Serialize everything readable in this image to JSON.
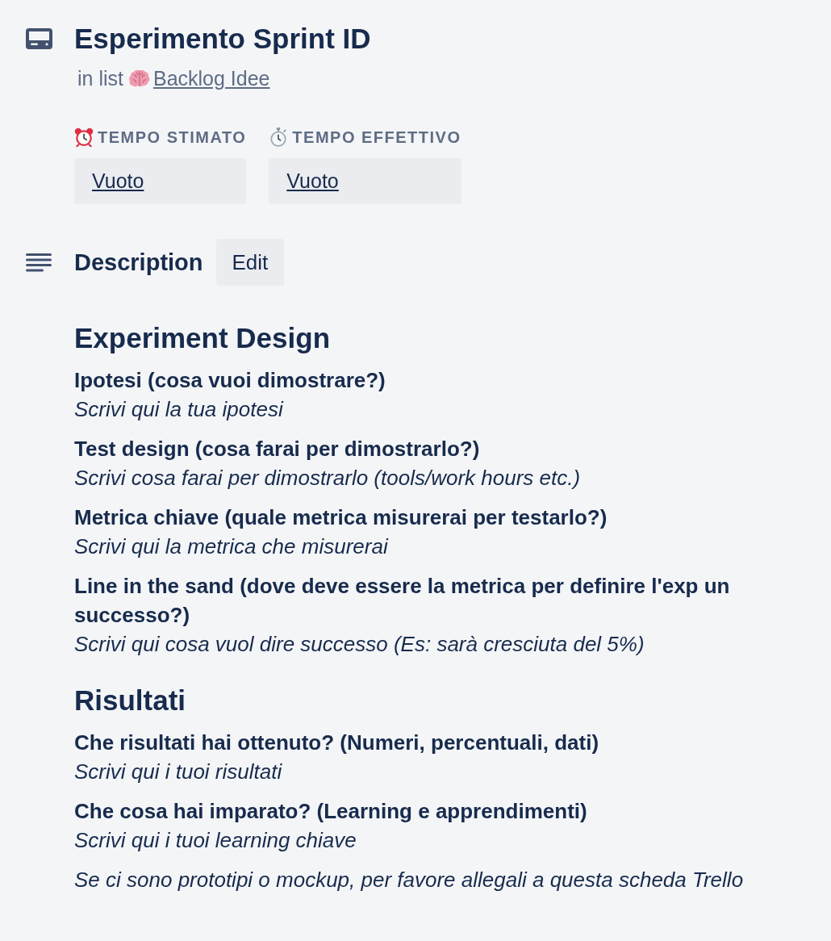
{
  "card": {
    "title": "Esperimento Sprint ID",
    "list_prefix": "in list",
    "list_name": "Backlog Idee"
  },
  "custom_fields": [
    {
      "label": "TEMPO STIMATO",
      "value": "Vuoto"
    },
    {
      "label": "TEMPO EFFETTIVO",
      "value": "Vuoto"
    }
  ],
  "description": {
    "title": "Description",
    "edit_button": "Edit",
    "blocks": [
      {
        "kind": "heading",
        "text": "Experiment Design"
      },
      {
        "kind": "item",
        "question": "Ipotesi (cosa vuoi dimostrare?)",
        "answer": "Scrivi qui la tua ipotesi"
      },
      {
        "kind": "item",
        "question": "Test design (cosa farai per dimostrarlo?)",
        "answer": "Scrivi cosa farai per dimostrarlo (tools/work hours etc.)"
      },
      {
        "kind": "item",
        "question": "Metrica chiave (quale metrica misurerai per testarlo?)",
        "answer": "Scrivi qui la metrica che misurerai"
      },
      {
        "kind": "item",
        "question": "Line in the sand (dove deve essere la metrica per definire l'exp un successo?)",
        "answer": "Scrivi qui cosa vuol dire successo (Es: sarà cresciuta del 5%)"
      },
      {
        "kind": "heading",
        "text": "Risultati"
      },
      {
        "kind": "item",
        "question": "Che risultati hai ottenuto? (Numeri, percentuali, dati)",
        "answer": "Scrivi qui i tuoi risultati"
      },
      {
        "kind": "item",
        "question": "Che cosa hai imparato? (Learning e apprendimenti)",
        "answer": "Scrivi qui i tuoi learning chiave"
      },
      {
        "kind": "note",
        "text": "Se ci sono prototipi o mockup, per favore allegali a questa scheda Trello"
      }
    ]
  }
}
